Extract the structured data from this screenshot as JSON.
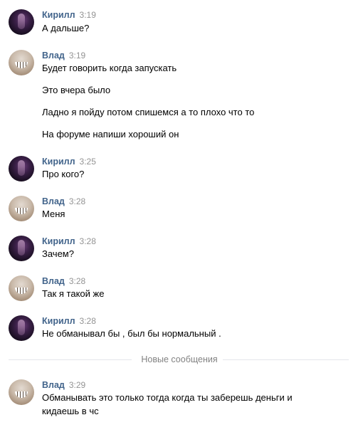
{
  "messages": [
    {
      "author": "Кирилл",
      "time": "3:19",
      "lines": [
        "А дальше?"
      ]
    },
    {
      "author": "Влад",
      "time": "3:19",
      "lines": [
        "Будет говорить когда запускать",
        "Это вчера было",
        "Ладно я пойду потом спишемся а то плохо что то",
        "На форуме напиши хороший он"
      ]
    },
    {
      "author": "Кирилл",
      "time": "3:25",
      "lines": [
        "Про кого?"
      ]
    },
    {
      "author": "Влад",
      "time": "3:28",
      "lines": [
        "Меня"
      ]
    },
    {
      "author": "Кирилл",
      "time": "3:28",
      "lines": [
        "Зачем?"
      ]
    },
    {
      "author": "Влад",
      "time": "3:28",
      "lines": [
        "Так я такой же"
      ]
    },
    {
      "author": "Кирилл",
      "time": "3:28",
      "lines": [
        "Не обманывал бы , был бы нормальный ."
      ]
    },
    {
      "author": "Влад",
      "time": "3:29",
      "lines": [
        "Обманывать это только тогда когда ты заберешь деньги и",
        "кидаешь в чс"
      ]
    }
  ],
  "divider": {
    "label": "Новые сообщения"
  }
}
